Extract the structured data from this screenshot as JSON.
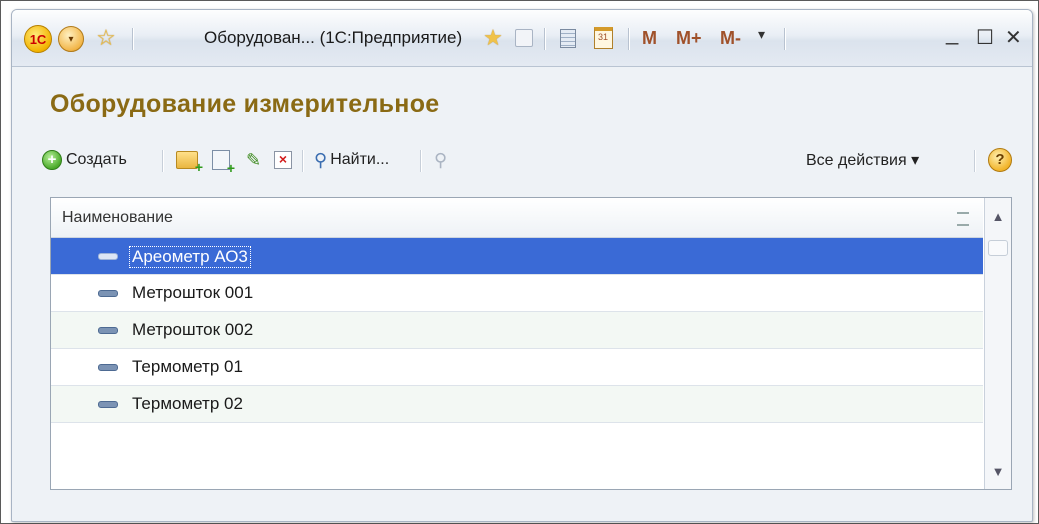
{
  "window": {
    "title": "Оборудован... (1С:Предприятие)",
    "logo_text": "1С",
    "m_label": "M",
    "m_plus_label": "M+",
    "m_minus_label": "M-",
    "minimize_glyph": "_",
    "maximize_glyph": "☐",
    "close_glyph": "✕"
  },
  "form": {
    "title": "Оборудование измерительное"
  },
  "toolbar": {
    "create_label": "Создать",
    "find_label": "Найти...",
    "all_actions_label": "Все действия ▾",
    "help_glyph": "?"
  },
  "table": {
    "column_header": "Наименование",
    "rows": [
      {
        "name": "Ареометр АО3",
        "selected": true
      },
      {
        "name": "Метрошток 001",
        "selected": false
      },
      {
        "name": "Метрошток 002",
        "selected": false
      },
      {
        "name": "Термометр 01",
        "selected": false
      },
      {
        "name": "Термометр 02",
        "selected": false
      }
    ]
  },
  "colors": {
    "title_color": "#8a6a14",
    "selection": "#3a6ad6"
  }
}
